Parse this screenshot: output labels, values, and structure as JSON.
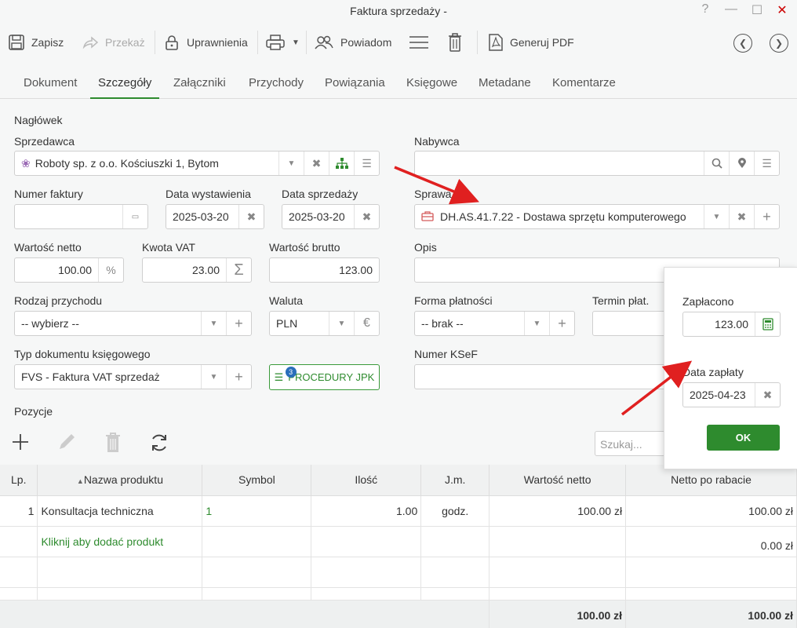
{
  "window": {
    "title": "Faktura sprzedaży -",
    "help": "?",
    "minimize": "—",
    "maximize": "☐",
    "close": "✕"
  },
  "toolbar": {
    "save": "Zapisz",
    "forward": "Przekaż",
    "permissions": "Uprawnienia",
    "notify": "Powiadom",
    "generate_pdf": "Generuj PDF"
  },
  "tabs": [
    "Dokument",
    "Szczegóły",
    "Załączniki",
    "Przychody",
    "Powiązania",
    "Księgowe",
    "Metadane",
    "Komentarze"
  ],
  "active_tab": "Szczegóły",
  "header_section": "Nagłówek",
  "seller": {
    "label": "Sprzedawca",
    "value": "Roboty sp. z o.o. Kościuszki 1, Bytom"
  },
  "buyer": {
    "label": "Nabywca",
    "value": ""
  },
  "invoice_number": {
    "label": "Numer faktury",
    "value": ""
  },
  "issue_date": {
    "label": "Data wystawienia",
    "value": "2025-03-20"
  },
  "sale_date": {
    "label": "Data sprzedaży",
    "value": "2025-03-20"
  },
  "case": {
    "label": "Sprawa",
    "value": "DH.AS.41.7.22 - Dostawa sprzętu komputerowego"
  },
  "net_value": {
    "label": "Wartość netto",
    "value": "100.00",
    "suffix": "%"
  },
  "vat_amount": {
    "label": "Kwota VAT",
    "value": "23.00",
    "suffix": "Σ"
  },
  "gross_value": {
    "label": "Wartość brutto",
    "value": "123.00"
  },
  "description": {
    "label": "Opis",
    "value": ""
  },
  "income_type": {
    "label": "Rodzaj przychodu",
    "value": "-- wybierz --"
  },
  "currency": {
    "label": "Waluta",
    "value": "PLN",
    "suffix": "€"
  },
  "payment_form": {
    "label": "Forma płatności",
    "value": "-- brak --"
  },
  "payment_term": {
    "label": "Termin płat.",
    "value": ""
  },
  "doc_type": {
    "label": "Typ dokumentu księgowego",
    "value": "FVS - Faktura VAT sprzedaż"
  },
  "jpk": {
    "label": "PROCEDURY JPK",
    "badge": "3"
  },
  "ksef": {
    "label": "Numer KSeF",
    "value": ""
  },
  "positions": {
    "title": "Pozycje",
    "search_placeholder": "Szukaj...",
    "columns": [
      "Lp.",
      "Nazwa produktu",
      "Symbol",
      "Ilość",
      "J.m.",
      "Wartość netto",
      "Netto po rabacie"
    ],
    "rows": [
      {
        "lp": "1",
        "name": "Konsultacja techniczna",
        "symbol": "1",
        "qty": "1.00",
        "unit": "godz.",
        "net": "100.00 zł",
        "net_disc": "100.00 zł"
      }
    ],
    "add_row": "Kliknij aby dodać produkt",
    "add_row_net_disc": "0.00 zł",
    "total_net": "100.00 zł",
    "total_net_disc": "100.00 zł"
  },
  "popup": {
    "paid_label": "Zapłacono",
    "paid_value": "123.00",
    "pay_date_label": "Data zapłaty",
    "pay_date_value": "2025-04-23",
    "ok": "OK"
  },
  "colors": {
    "accent": "#2e8b2e",
    "arrow": "#e02020"
  }
}
